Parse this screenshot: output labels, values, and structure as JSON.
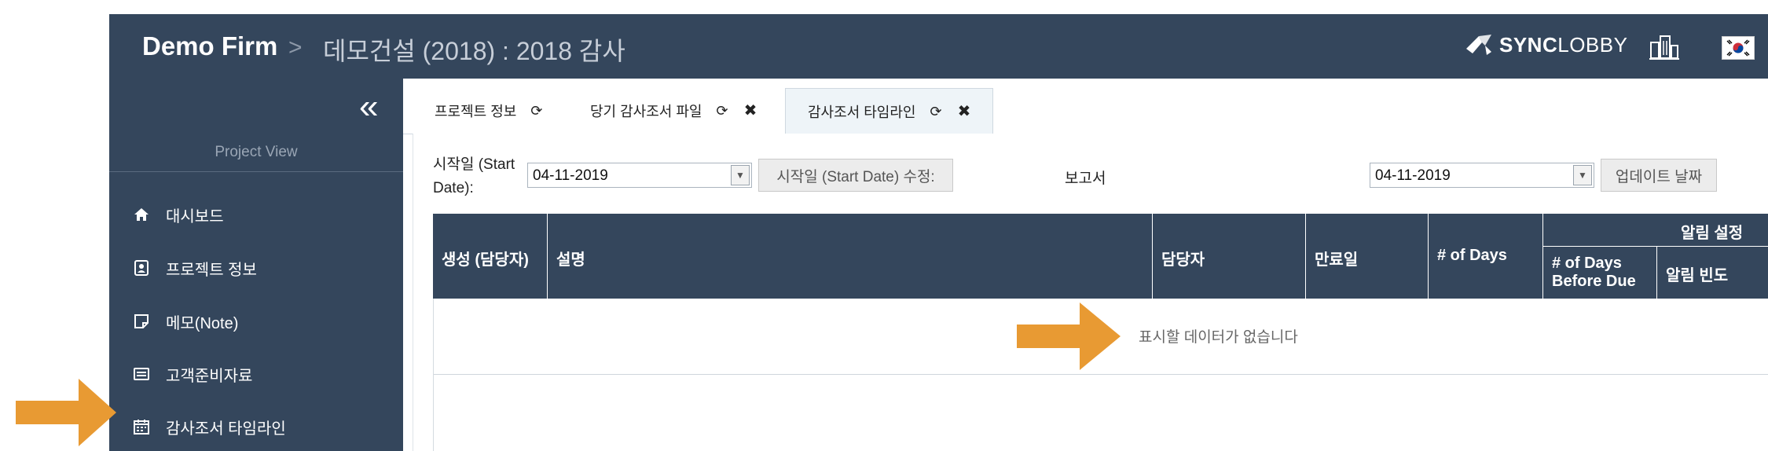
{
  "header": {
    "brand": "Demo Firm",
    "separator": ">",
    "project_title": "데모건설 (2018) : 2018 감사",
    "sync_logo_bold": "SYNC",
    "sync_logo_light": "LOBBY"
  },
  "sidebar": {
    "collapse_icon": "«",
    "section_label": "Project View",
    "items": [
      {
        "label": "대시보드",
        "icon": "home-icon"
      },
      {
        "label": "프로젝트 정보",
        "icon": "contact-card-icon"
      },
      {
        "label": "메모(Note)",
        "icon": "note-icon"
      },
      {
        "label": "고객준비자료",
        "icon": "monitor-icon"
      },
      {
        "label": "감사조서 타임라인",
        "icon": "calendar-icon"
      }
    ]
  },
  "tabs": [
    {
      "label": "프로젝트 정보",
      "refresh": "⟳",
      "closable": false
    },
    {
      "label": "당기 감사조서 파일",
      "refresh": "⟳",
      "close": "✖"
    },
    {
      "label": "감사조서 타임라인",
      "refresh": "⟳",
      "close": "✖",
      "active": true
    }
  ],
  "controls": {
    "start_label": "시작일 (Start Date):",
    "start_value": "04-11-2019",
    "start_button": "시작일 (Start Date) 수정:",
    "report_label": "보고서",
    "report_value": "04-11-2019",
    "update_button": "업데이트 날짜"
  },
  "table": {
    "columns": [
      "생성 (담당자)",
      "설명",
      "담당자",
      "만료일",
      "# of Days"
    ],
    "group_header": "알림 설정",
    "sub_columns": [
      "# of Days Before Due",
      "알림 빈도"
    ],
    "empty_message": "표시할 데이터가 없습니다"
  },
  "colors": {
    "sidebar_bg": "#34465c",
    "arrow": "#e89a33"
  }
}
